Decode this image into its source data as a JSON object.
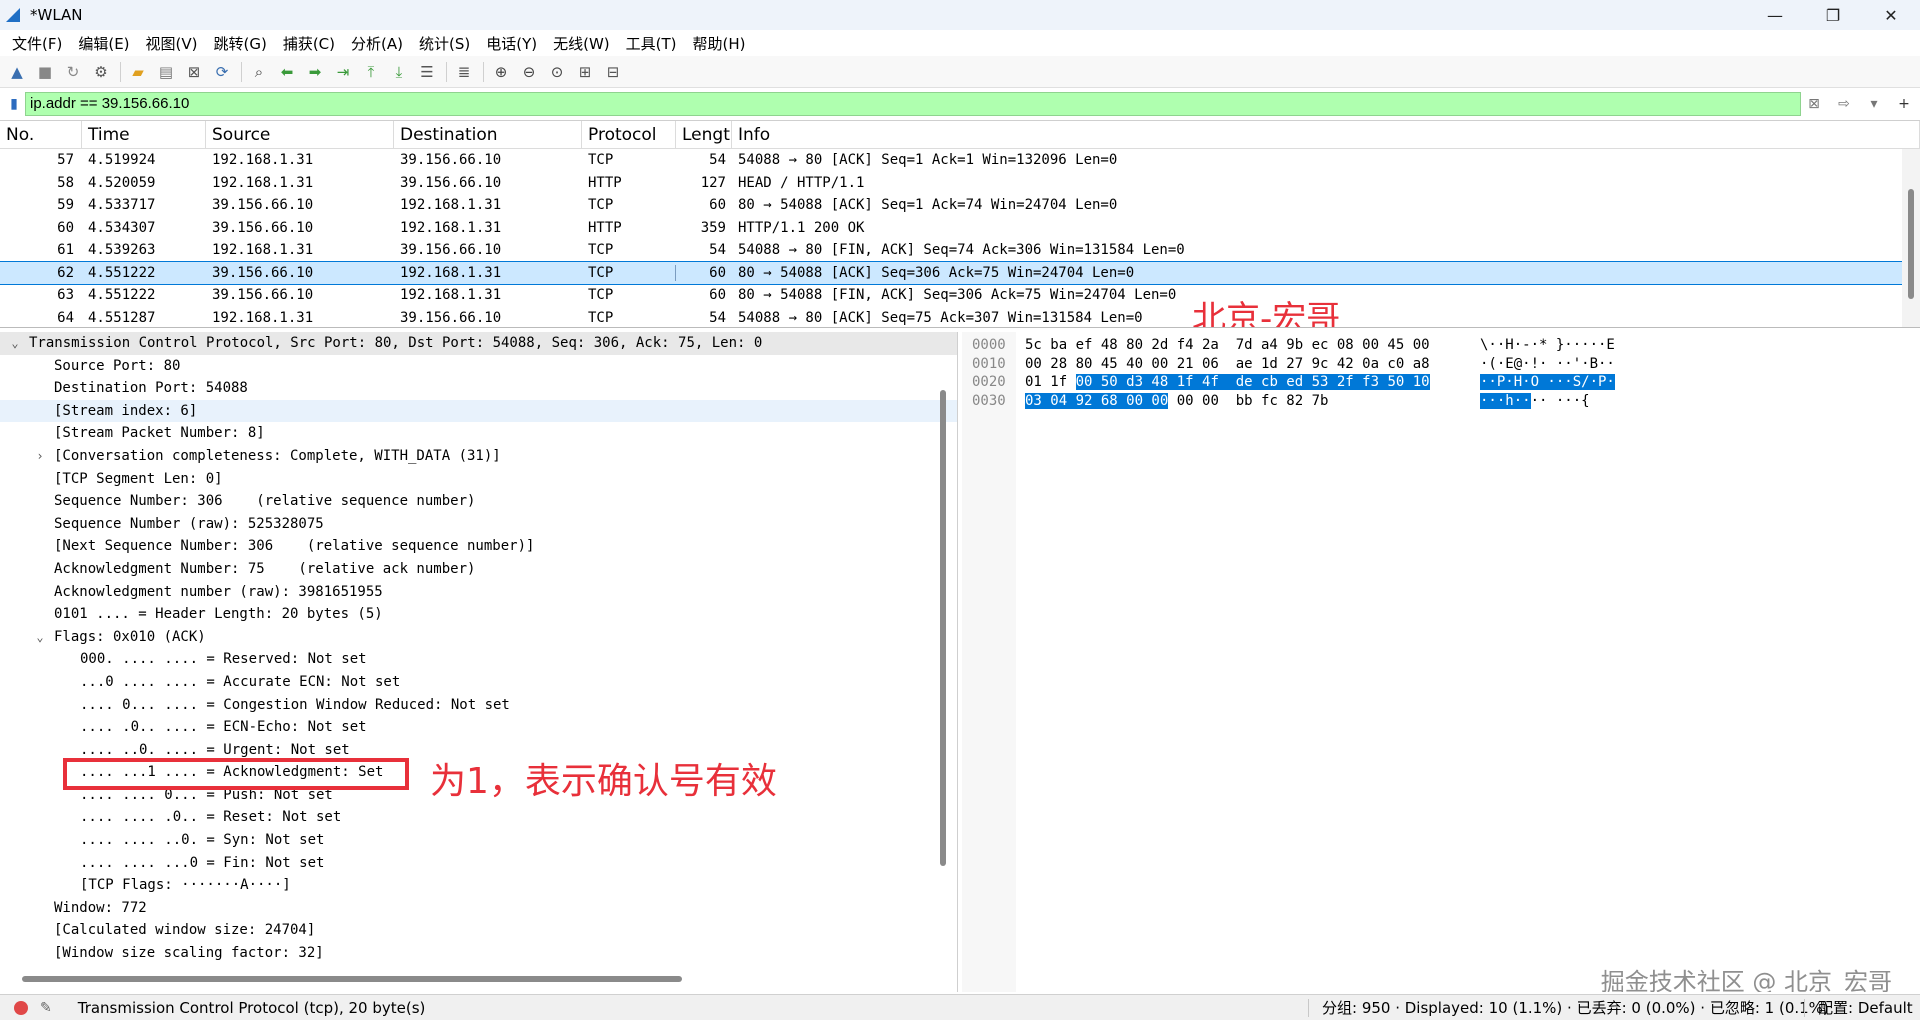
{
  "window": {
    "title": "*WLAN",
    "minimize": "—",
    "maximize": "❐",
    "close": "✕"
  },
  "menu": [
    "文件(F)",
    "编辑(E)",
    "视图(V)",
    "跳转(G)",
    "捕获(C)",
    "分析(A)",
    "统计(S)",
    "电话(Y)",
    "无线(W)",
    "工具(T)",
    "帮助(H)"
  ],
  "filter": {
    "value": "ip.addr == 39.156.66.10"
  },
  "packet_list": {
    "columns": {
      "no": "No.",
      "time": "Time",
      "source": "Source",
      "destination": "Destination",
      "protocol": "Protocol",
      "length": "Lengt",
      "info": "Info"
    },
    "rows": [
      {
        "no": "57",
        "time": "4.519924",
        "source": "192.168.1.31",
        "destination": "39.156.66.10",
        "protocol": "TCP",
        "length": "54",
        "info": "54088 → 80 [ACK] Seq=1 Ack=1 Win=132096 Len=0"
      },
      {
        "no": "58",
        "time": "4.520059",
        "source": "192.168.1.31",
        "destination": "39.156.66.10",
        "protocol": "HTTP",
        "length": "127",
        "info": "HEAD / HTTP/1.1"
      },
      {
        "no": "59",
        "time": "4.533717",
        "source": "39.156.66.10",
        "destination": "192.168.1.31",
        "protocol": "TCP",
        "length": "60",
        "info": "80 → 54088 [ACK] Seq=1 Ack=74 Win=24704 Len=0"
      },
      {
        "no": "60",
        "time": "4.534307",
        "source": "39.156.66.10",
        "destination": "192.168.1.31",
        "protocol": "HTTP",
        "length": "359",
        "info": "HTTP/1.1 200 OK"
      },
      {
        "no": "61",
        "time": "4.539263",
        "source": "192.168.1.31",
        "destination": "39.156.66.10",
        "protocol": "TCP",
        "length": "54",
        "info": "54088 → 80 [FIN, ACK] Seq=74 Ack=306 Win=131584 Len=0"
      },
      {
        "no": "62",
        "time": "4.551222",
        "source": "39.156.66.10",
        "destination": "192.168.1.31",
        "protocol": "TCP",
        "length": "60",
        "info": "80 → 54088 [ACK] Seq=306 Ack=75 Win=24704 Len=0"
      },
      {
        "no": "63",
        "time": "4.551222",
        "source": "39.156.66.10",
        "destination": "192.168.1.31",
        "protocol": "TCP",
        "length": "60",
        "info": "80 → 54088 [FIN, ACK] Seq=306 Ack=75 Win=24704 Len=0"
      },
      {
        "no": "64",
        "time": "4.551287",
        "source": "192.168.1.31",
        "destination": "39.156.66.10",
        "protocol": "TCP",
        "length": "54",
        "info": "54088 → 80 [ACK] Seq=75 Ack=307 Win=131584 Len=0"
      }
    ]
  },
  "overlay": {
    "watermark_top": "北京-宏哥",
    "annotation": "为1，表示确认号有效",
    "watermark_bottom": "掘金技术社区 @ 北京_宏哥"
  },
  "details": [
    {
      "text": "Transmission Control Protocol, Src Port: 80, Dst Port: 54088, Seq: 306, Ack: 75, Len: 0"
    },
    {
      "text": "Source Port: 80"
    },
    {
      "text": "Destination Port: 54088"
    },
    {
      "text": "[Stream index: 6]"
    },
    {
      "text": "[Stream Packet Number: 8]"
    },
    {
      "text": "[Conversation completeness: Complete, WITH_DATA (31)]"
    },
    {
      "text": "[TCP Segment Len: 0]"
    },
    {
      "text": "Sequence Number: 306    (relative sequence number)"
    },
    {
      "text": "Sequence Number (raw): 525328075"
    },
    {
      "text": "[Next Sequence Number: 306    (relative sequence number)]"
    },
    {
      "text": "Acknowledgment Number: 75    (relative ack number)"
    },
    {
      "text": "Acknowledgment number (raw): 3981651955"
    },
    {
      "text": "0101 .... = Header Length: 20 bytes (5)"
    },
    {
      "text": "Flags: 0x010 (ACK)"
    },
    {
      "text": "000. .... .... = Reserved: Not set"
    },
    {
      "text": "...0 .... .... = Accurate ECN: Not set"
    },
    {
      "text": ".... 0... .... = Congestion Window Reduced: Not set"
    },
    {
      "text": ".... .0.. .... = ECN-Echo: Not set"
    },
    {
      "text": ".... ..0. .... = Urgent: Not set"
    },
    {
      "text": ".... ...1 .... = Acknowledgment: Set"
    },
    {
      "text": ".... .... 0... = Push: Not set"
    },
    {
      "text": ".... .... .0.. = Reset: Not set"
    },
    {
      "text": ".... .... ..0. = Syn: Not set"
    },
    {
      "text": ".... .... ...0 = Fin: Not set"
    },
    {
      "text": "[TCP Flags: ·······A····]"
    },
    {
      "text": "Window: 772"
    },
    {
      "text": "[Calculated window size: 24704]"
    },
    {
      "text": "[Window size scaling factor: 32]"
    }
  ],
  "bytes": {
    "offsets": [
      "0000",
      "0010",
      "0020",
      "0030"
    ],
    "hex": [
      {
        "pre": "5c ba ef 48 80 2d f4 2a  7d a4 9b ec 08 00 45 00",
        "sel": "",
        "post": ""
      },
      {
        "pre": "00 28 80 45 40 00 21 06  ae 1d 27 9c 42 0a c0 a8",
        "sel": "",
        "post": ""
      },
      {
        "pre": "01 1f ",
        "sel": "00 50 d3 48 1f 4f  de cb ed 53 2f f3 50 10",
        "post": ""
      },
      {
        "pre": "",
        "sel": "03 04 92 68 00 00",
        "post": " 00 00  bb fc 82 7b"
      }
    ],
    "ascii": [
      {
        "pre": "\\··H·-·* }·····E",
        "sel": "",
        "post": ""
      },
      {
        "pre": "·(·E@·!· ··'·B··",
        "sel": "",
        "post": ""
      },
      {
        "pre": "",
        "sel": "··P·H·O ···S/·P·",
        "post": ""
      },
      {
        "pre": "",
        "sel": "···h··",
        "post": "·· ···{"
      }
    ]
  },
  "status": {
    "text": "Transmission Control Protocol (tcp), 20 byte(s)",
    "stats": "分组: 950 · Displayed: 10 (1.1%) · 已丢弃: 0 (0.0%) · 已忽略: 1 (0.1%)",
    "profile": "配置: Default"
  }
}
